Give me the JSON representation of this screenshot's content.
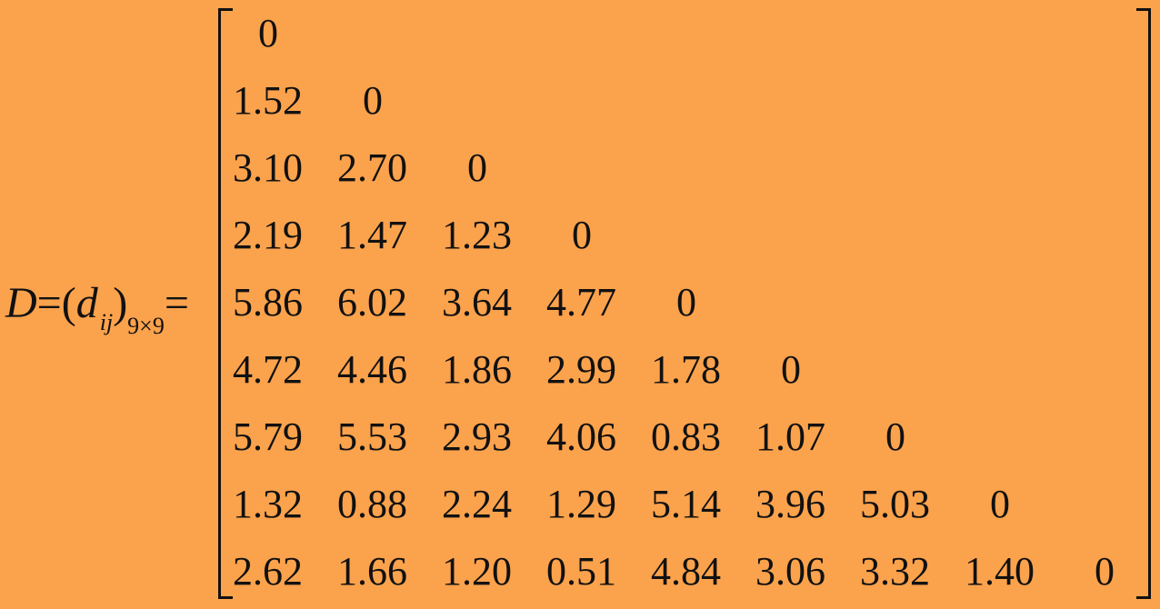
{
  "lhs": {
    "symbol": "D",
    "eq1": "=",
    "lparen": "(",
    "element": "d",
    "element_sub": "ij",
    "rparen": ")",
    "size_sub": "9×9",
    "eq2": "="
  },
  "matrix": [
    [
      "0"
    ],
    [
      "1.52",
      "0"
    ],
    [
      "3.10",
      "2.70",
      "0"
    ],
    [
      "2.19",
      "1.47",
      "1.23",
      "0"
    ],
    [
      "5.86",
      "6.02",
      "3.64",
      "4.77",
      "0"
    ],
    [
      "4.72",
      "4.46",
      "1.86",
      "2.99",
      "1.78",
      "0"
    ],
    [
      "5.79",
      "5.53",
      "2.93",
      "4.06",
      "0.83",
      "1.07",
      "0"
    ],
    [
      "1.32",
      "0.88",
      "2.24",
      "1.29",
      "5.14",
      "3.96",
      "5.03",
      "0"
    ],
    [
      "2.62",
      "1.66",
      "1.20",
      "0.51",
      "4.84",
      "3.06",
      "3.32",
      "1.40",
      "0"
    ]
  ]
}
